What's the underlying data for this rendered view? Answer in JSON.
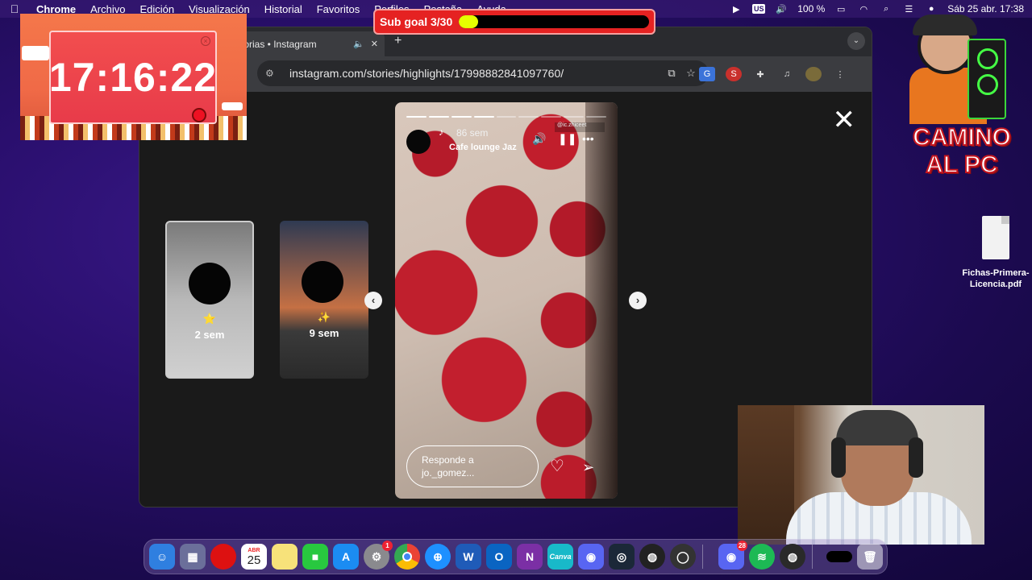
{
  "menubar": {
    "app_name": "Chrome",
    "items": [
      "Archivo",
      "Edición",
      "Visualización",
      "Historial",
      "Favoritos",
      "Perfiles",
      "Pestaña",
      "Ayuda"
    ],
    "input_source": "US",
    "battery": "100 %",
    "datetime": "Sáb 25 abr.  17:38"
  },
  "subgoal": {
    "label": "Sub goal 3/30",
    "progress": 0.1
  },
  "clock": {
    "time": "17:16:22"
  },
  "browser": {
    "tab_title": "torias • Instagram",
    "url": "instagram.com/stories/highlights/17998882841097760/"
  },
  "stories": {
    "thumbs": [
      {
        "emoji": "⭐",
        "label": "2 sem"
      },
      {
        "emoji": "✨",
        "label": "9 sem"
      }
    ],
    "active": {
      "age": "86 sem",
      "song": "Cafe lounge Jaz",
      "mention": "@ic.zhiceet",
      "reply_placeholder_line1": "Responde a",
      "reply_placeholder_line2": "jo._gomez...",
      "progress_done": 4,
      "progress_total": 9
    }
  },
  "logo": {
    "line1": "CAMINO",
    "line2": "AL PC"
  },
  "desktop_file": {
    "name_line1": "Fichas-Primera-",
    "name_line2": "Licencia.pdf"
  },
  "dock": {
    "calendar_month": "ABR",
    "calendar_day": "25",
    "settings_badge": "1",
    "discord_badge": "28",
    "apps": [
      "finder",
      "launchpad",
      "red-app",
      "calendar",
      "notes",
      "facetime",
      "app-store",
      "settings",
      "chrome",
      "safari",
      "word",
      "outlook",
      "onenote",
      "canva",
      "discord",
      "steam",
      "obs",
      "webcam-app",
      "discord-2",
      "spotify",
      "obs-2",
      "black-app",
      "trash"
    ]
  },
  "colors": {
    "menubar_bg": "#3c1e78",
    "subgoal_bg": "#e52222",
    "subgoal_fill": "#e6ff00",
    "clock_face": "#f24e4e",
    "chrome_bg": "#1f1f1f",
    "omnibox_bg": "#28292c"
  }
}
